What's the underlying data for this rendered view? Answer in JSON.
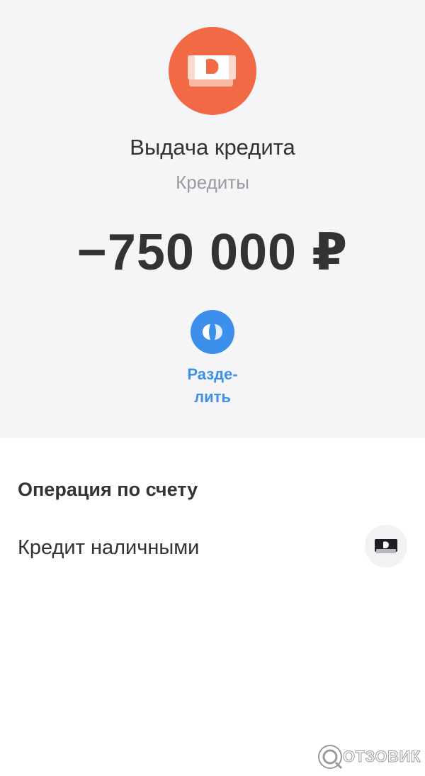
{
  "header": {
    "icon": "credit-cash-icon",
    "icon_color": "#f26a45",
    "title": "Выдача кредита",
    "category": "Кредиты",
    "amount": "−750 000 ₽"
  },
  "split_action": {
    "icon": "split-icon",
    "icon_color": "#3d8fec",
    "label": "Разде-\nлить"
  },
  "operation_section": {
    "heading": "Операция по счету",
    "account": {
      "label": "Кредит наличными",
      "icon": "cash-card-icon"
    }
  },
  "watermark": {
    "text": "ОТЗОВИК"
  }
}
